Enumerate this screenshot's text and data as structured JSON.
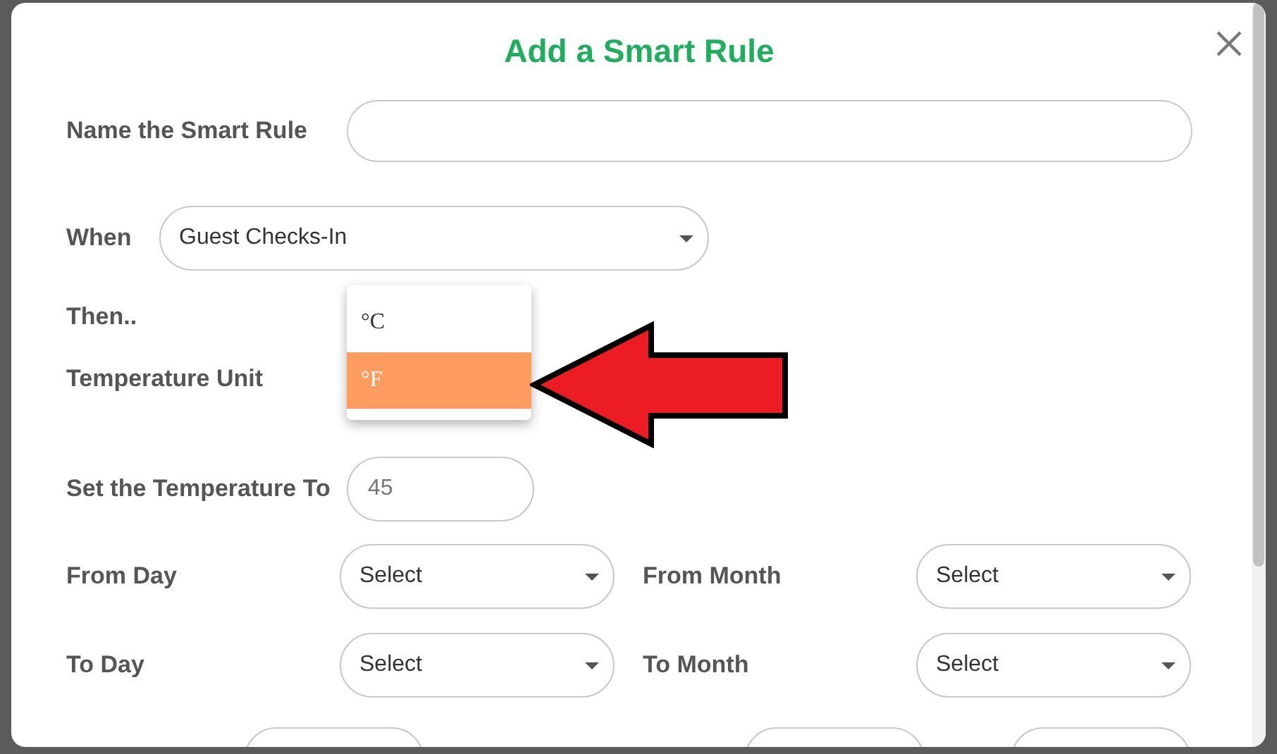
{
  "dialog": {
    "title": "Add a Smart Rule",
    "name_field": {
      "label": "Name the Smart Rule"
    },
    "when": {
      "label": "When",
      "value": "Guest Checks-In"
    },
    "then_label": "Then..",
    "temperature_unit": {
      "label": "Temperature Unit",
      "options": [
        {
          "label": "°C",
          "selected": false
        },
        {
          "label": "°F",
          "selected": true
        }
      ]
    },
    "temperature": {
      "label": "Set the Temperature To",
      "value": "45"
    },
    "date_rows": [
      {
        "left": {
          "label": "From Day",
          "value": "Select"
        },
        "right": {
          "label": "From Month",
          "value": "Select"
        }
      },
      {
        "left": {
          "label": "To Day",
          "value": "Select"
        },
        "right": {
          "label": "To Month",
          "value": "Select"
        }
      }
    ]
  }
}
